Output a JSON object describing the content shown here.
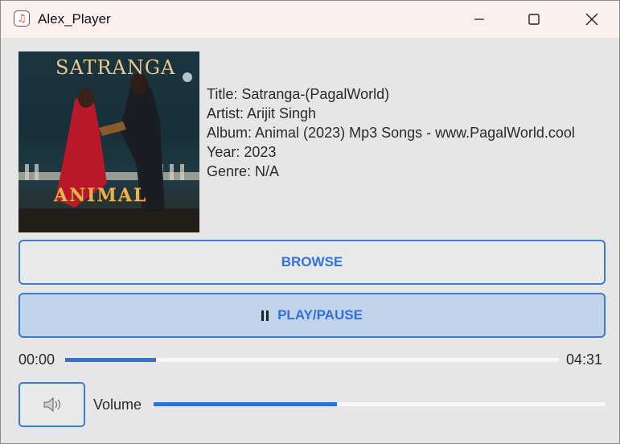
{
  "window": {
    "title": "Alex_Player",
    "icon": "music-note-icon"
  },
  "album_art": {
    "title_text": "SATRANGA",
    "movie_text": "ANIMAL"
  },
  "metadata": {
    "title": "Title: Satranga-(PagalWorld)",
    "artist": "Artist: Arijit Singh",
    "album": "Album: Animal (2023) Mp3 Songs - www.PagalWorld.cool",
    "year": "Year: 2023",
    "genre": "Genre: N/A"
  },
  "controls": {
    "browse_label": "BROWSE",
    "play_pause_label": "PLAY/PAUSE",
    "play_pause_icon": "pause-icon"
  },
  "progress": {
    "current_time": "00:00",
    "total_time": "04:31",
    "fraction": 0.184
  },
  "volume": {
    "label": "Volume",
    "icon": "speaker-icon",
    "fraction": 0.406
  },
  "colors": {
    "accent": "#2e72d9",
    "play_button_bg": "#c2d3ec",
    "titlebar_bg": "#faf1ee"
  }
}
